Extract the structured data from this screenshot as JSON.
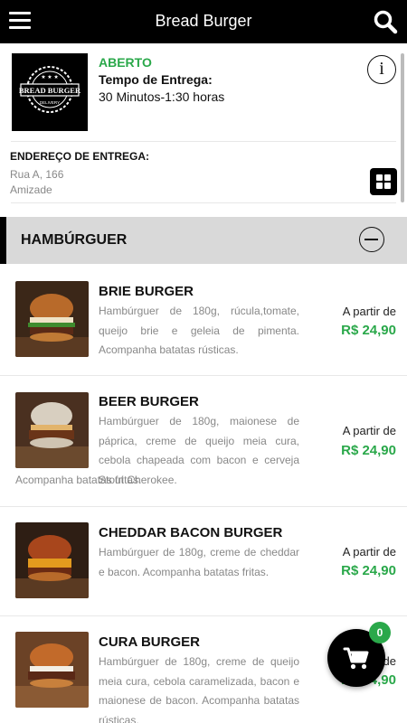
{
  "header": {
    "title": "Bread Burger",
    "menu_icon": "hamburger-menu-icon",
    "search_icon": "search-icon"
  },
  "store": {
    "logo_text": "BREAD BURGER",
    "logo_sub": "DELIVERY",
    "status": "ABERTO",
    "delivery_label": "Tempo de Entrega:",
    "delivery_time": "30 Minutos-1:30 horas",
    "info_icon": "info-icon"
  },
  "address": {
    "label": "ENDEREÇO DE ENTREGA:",
    "line1": "Rua A, 166",
    "line2": "Amizade",
    "grid_icon": "grid-view-icon"
  },
  "category": {
    "name": "HAMBÚRGUER",
    "collapse_icon": "minus-circle-icon"
  },
  "products": [
    {
      "name": "BRIE BURGER",
      "description": "Hambúrguer de 180g, rúcula,tomate, queijo brie e geleia de pimenta. Acompanha batatas rústicas.",
      "price_label": "A partir de",
      "price": "R$ 24,90"
    },
    {
      "name": "BEER BURGER",
      "description": "Hambúrguer de 180g, maionese de páprica, creme de queijo meia cura, cebola chapeada com bacon e cerveja Stout Cherokee.",
      "description_tail": "Acompanha batatas fritas.",
      "price_label": "A partir de",
      "price": "R$ 24,90"
    },
    {
      "name": "CHEDDAR BACON BURGER",
      "description": "Hambúrguer de 180g, creme de cheddar e bacon. Acompanha batatas fritas.",
      "price_label": "A partir de",
      "price": "R$ 24,90"
    },
    {
      "name": "CURA BURGER",
      "description": "Hambúrguer de 180g, creme de queijo meia cura, cebola caramelizada, bacon e maionese de bacon. Acompanha batatas rústicas.",
      "price_label": "A partir de",
      "price": "R$ 24,90"
    }
  ],
  "cart": {
    "count": "0",
    "icon": "shopping-cart-icon"
  },
  "colors": {
    "accent_green": "#2aa84a",
    "header_bg": "#000000",
    "category_bg": "#d9d9d9"
  }
}
